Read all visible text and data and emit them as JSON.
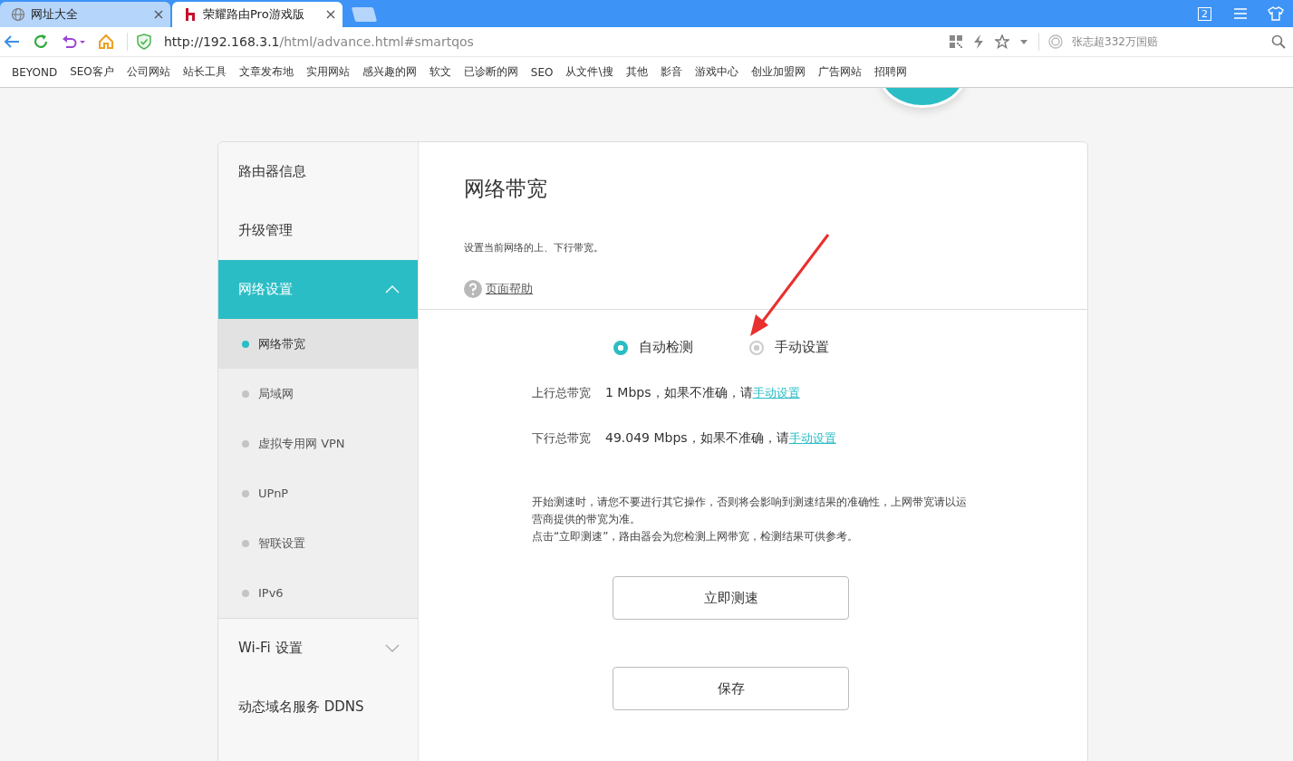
{
  "browser": {
    "tabs": [
      {
        "title": "网址大全",
        "selected": false
      },
      {
        "title": "荣耀路由Pro游戏版",
        "selected": true
      }
    ],
    "window_count": "2",
    "url": {
      "host": "http://192.168.3.1",
      "path": "/html/advance.html#smartqos"
    },
    "search": {
      "placeholder": "张志超332万国赔"
    },
    "bookmarks": [
      "BEYOND",
      "SEO客户",
      "公司网站",
      "站长工具",
      "文章发布地",
      "实用网站",
      "感兴趣的网",
      "软文",
      "已诊断的网",
      "SEO",
      "从文件\\搜",
      "其他",
      "影音",
      "游戏中心",
      "创业加盟网",
      "广告网站",
      "招聘网"
    ]
  },
  "sidebar": {
    "items": [
      {
        "label": "路由器信息",
        "kind": "item",
        "selected": false
      },
      {
        "label": "升级管理",
        "kind": "item",
        "selected": false
      },
      {
        "label": "网络设置",
        "kind": "group",
        "selected": true,
        "expanded": true,
        "children": [
          {
            "label": "网络带宽",
            "selected": true
          },
          {
            "label": "局域网",
            "selected": false
          },
          {
            "label": "虚拟专用网 VPN",
            "selected": false
          },
          {
            "label": "UPnP",
            "selected": false
          },
          {
            "label": "智联设置",
            "selected": false
          },
          {
            "label": "IPv6",
            "selected": false
          }
        ]
      },
      {
        "label": "Wi-Fi 设置",
        "kind": "group",
        "selected": false,
        "expanded": false
      },
      {
        "label": "动态域名服务 DDNS",
        "kind": "item",
        "selected": false
      }
    ]
  },
  "content": {
    "title": "网络带宽",
    "description": "设置当前网络的上、下行带宽。",
    "help_link": "页面帮助",
    "mode_options": [
      {
        "label": "自动检测",
        "selected": true
      },
      {
        "label": "手动设置",
        "selected": false
      }
    ],
    "rows": [
      {
        "label": "上行总带宽",
        "value": "1 Mbps，如果不准确，请",
        "link": "手动设置"
      },
      {
        "label": "下行总带宽",
        "value": "49.049 Mbps，如果不准确，请",
        "link": "手动设置"
      }
    ],
    "notes": [
      "开始测速时，请您不要进行其它操作，否则将会影响到测速结果的准确性，上网带宽请以运营商提供的带宽为准。",
      "点击“立即测速”，路由器会为您检测上网带宽，检测结果可供参考。"
    ],
    "buttons": [
      "立即测速",
      "保存"
    ]
  }
}
